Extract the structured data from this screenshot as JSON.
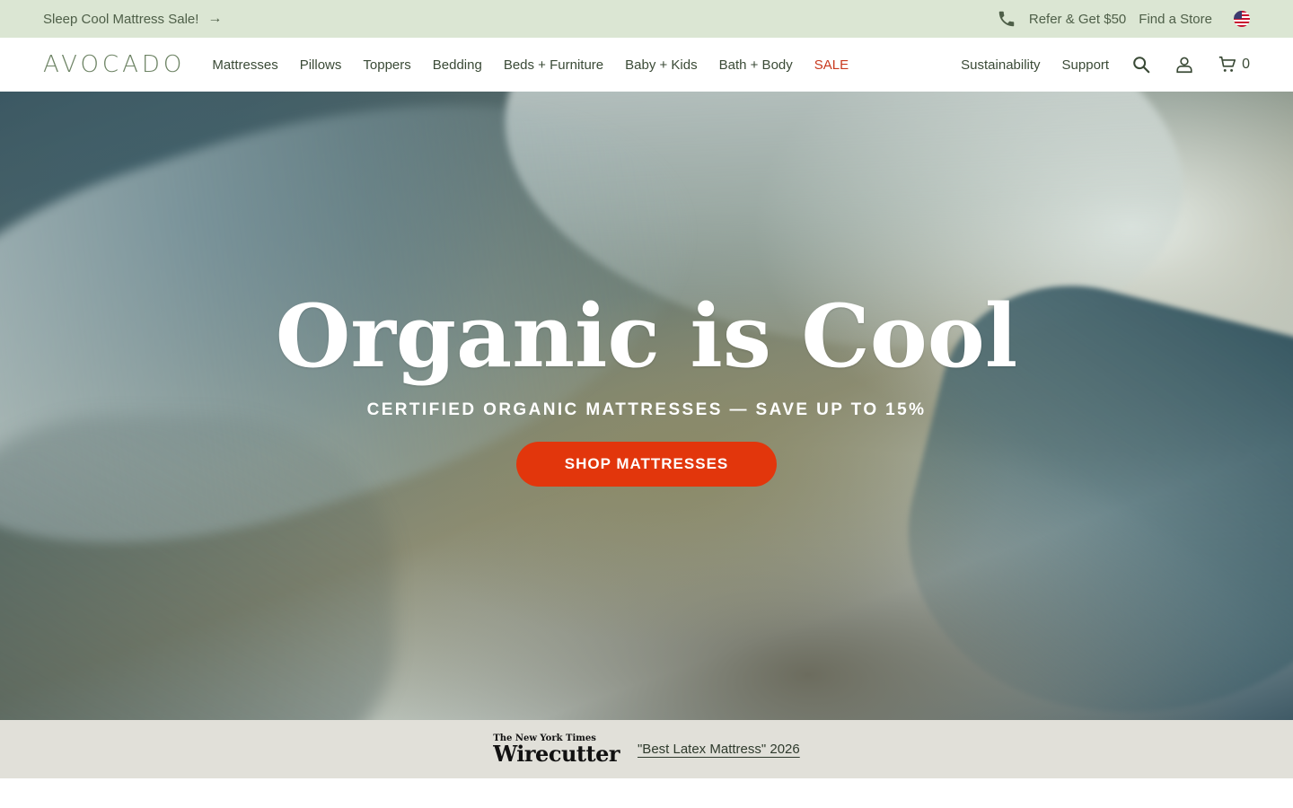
{
  "promo": {
    "text": "Sleep Cool Mattress Sale!",
    "arrow_icon": "arrow-right-icon",
    "refer_label": "Refer & Get $50",
    "store_label": "Find a Store",
    "phone_icon": "phone-icon",
    "flag_icon": "us-flag-icon",
    "bg_color": "#dbe6d3"
  },
  "nav": {
    "logo": "AVOCADO",
    "links": [
      "Mattresses",
      "Pillows",
      "Toppers",
      "Bedding",
      "Beds + Furniture",
      "Baby + Kids",
      "Bath + Body"
    ],
    "sale_label": "SALE",
    "sale_color": "#c8391e",
    "right_links": [
      "Sustainability",
      "Support"
    ],
    "search_icon": "search-icon",
    "account_icon": "user-icon",
    "cart_icon": "cart-icon",
    "cart_count": "0"
  },
  "hero": {
    "title": "Organic is Cool",
    "subtitle": "CERTIFIED ORGANIC MATTRESSES — SAVE UP TO 15%",
    "cta_label": "SHOP MATTRESSES",
    "cta_color": "#e2360c"
  },
  "press": {
    "source_top": "The New York Times",
    "source_main": "Wirecutter",
    "quote": "\"Best Latex Mattress\" 2026",
    "bg_color": "#e1e0d9"
  }
}
